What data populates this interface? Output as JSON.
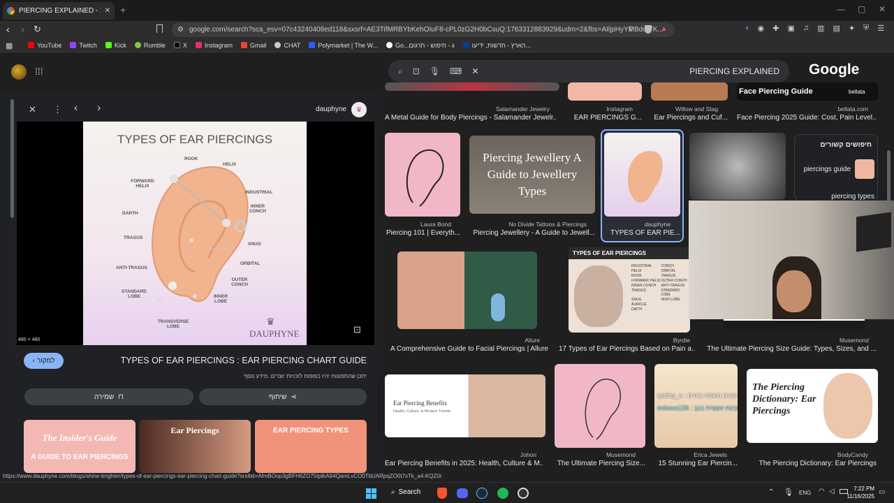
{
  "browser": {
    "tab_title": "PIERCING EXPLAINED - חיפוש ב",
    "url": "google.com/search?sca_esv=07c43240408ed118&sxsrf=AE3TifMRBYbKehOIuF8-cPL0zG2H0bCsuQ:1763312883929&udm=2&fbs=AIljpHyYMBdor7K...",
    "bookmarks": [
      "YouTube",
      "Twitch",
      "Kick",
      "Rumble",
      "X",
      "Instagram",
      "Gmail",
      "CHAT",
      "Polymarket | The W...",
      "Go...ג - חיפוש - תרגום",
      "הארץ - חדשות, ידיעו..."
    ],
    "status_url": "https://www.dauphyne.com/blogs/shine-brighter/types-of-ear-piercings-ear-piercing-chart-guide?srsltid=AfmBOop3gBFH6ZO75tplbA94QamLvCO0TbUARpqZO0t7xTk_a4-KQZ0r"
  },
  "search": {
    "query": "PIERCING EXPLAINED",
    "logo": "Google"
  },
  "panel": {
    "source": "dauphyne",
    "dims": "480 × 480",
    "title": "TYPES OF EAR PIERCINGS : EAR PIERCING CHART GUIDE",
    "visit": "למקור",
    "notice": "יתכן שהתמונות יהיו כפופות לזכויות יוצרים. מידע נוסף",
    "save": "שמירה",
    "share": "שיתוף",
    "image": {
      "heading": "TYPES OF EAR PIERCINGS",
      "brand": "DAUPHYNE",
      "labels": [
        "ROOK",
        "HELIX",
        "FORWARD HELIX",
        "INDUSTRIAL",
        "INNER CONCH",
        "DARTH",
        "TRAGUS",
        "SNUG",
        "ORBITAL",
        "ANTI-TRAGUS",
        "OUTER CONCH",
        "STANDARD LOBE",
        "INNER LOBE",
        "TRANSVERSE LOBE"
      ]
    },
    "related": [
      "The Insider's Guide",
      "A GUIDE TO EAR PIERCINGS",
      "Ear Piercings",
      "EAR PIERCING TYPES"
    ]
  },
  "results": {
    "row0": [
      {
        "src": "Salamander Jewelry",
        "cap": "A Metal Guide for Body Piercings - Salamander Jewelr..."
      },
      {
        "src": "Instagram",
        "cap": "EAR PIERCINGS G..."
      },
      {
        "src": "Willow and Stag",
        "cap": "Ear Piercings and Cuf..."
      },
      {
        "src": "bellata.com",
        "cap": "Face Piercing 2025 Guide: Cost, Pain Level..."
      }
    ],
    "face_banner": "Face Piercing Guide",
    "bellata": "bellata",
    "row1": [
      {
        "src": "Laura Bond",
        "cap": "Piercing 101 | Everyth..."
      },
      {
        "src": "No Divide Tattoos & Piercings",
        "cap": "Piercing Jewellery - A Guide to Jewell..."
      },
      {
        "src": "dauphyne",
        "cap": "TYPES OF EAR PIE..."
      }
    ],
    "jewellery_text": "Piercing Jewellery A Guide to Jewellery Types",
    "related_title": "חיפושים קשורים",
    "related_items": [
      "piercings guide",
      "piercing types"
    ],
    "row2": [
      {
        "src": "Allure",
        "cap": "A Comprehensive Guide to Facial Piercings | Allure"
      },
      {
        "src": "Byrdie",
        "cap": "17 Types of Ear Piercings Based on Pain a..."
      },
      {
        "src": "Musemond",
        "cap": "The Ultimate Piercing Size Guide: Types, Sizes, and ..."
      }
    ],
    "byrdie_title": "TYPES OF EAR PIERCINGS",
    "byrdie_list": [
      "INDUSTRIAL",
      "HELIX",
      "ROOK",
      "FORWARD HELIX",
      "INNER CONCH",
      "TRAGUS",
      "SNUG",
      "AURICLE",
      "DAITH",
      "CONCH",
      "ORBITAL",
      "TRAGUS",
      "OUTER CONCH",
      "ANTI-TRAGUS",
      "STANDARD LOBE",
      "HIGH LOBE"
    ],
    "row3": [
      {
        "src": "Johori",
        "cap": "Ear Piercing Benefits in 2025: Health, Culture & M..."
      },
      {
        "src": "Musemond",
        "cap": "The Ultimate Piercing Size..."
      },
      {
        "src": "Erica Jewels",
        "cap": "15 Stunning Ear Piercin..."
      },
      {
        "src": "BodyCandy",
        "cap": "The Piercing Dictionary: Ear Piercings"
      }
    ],
    "johori_text": "Ear Piercing Benefits",
    "johori_sub": "Health, Culture, & Modern Trends",
    "dict_text": "The Piercing Dictionary: Ear Piercings",
    "chat": [
      "spidey_a : קונים משפט בוטים",
      "mrboos126 : טבעת עקשית בגב"
    ]
  },
  "taskbar": {
    "search": "Search",
    "lang": "ENG",
    "time": "7:22 PM",
    "date": "11/16/2025"
  }
}
